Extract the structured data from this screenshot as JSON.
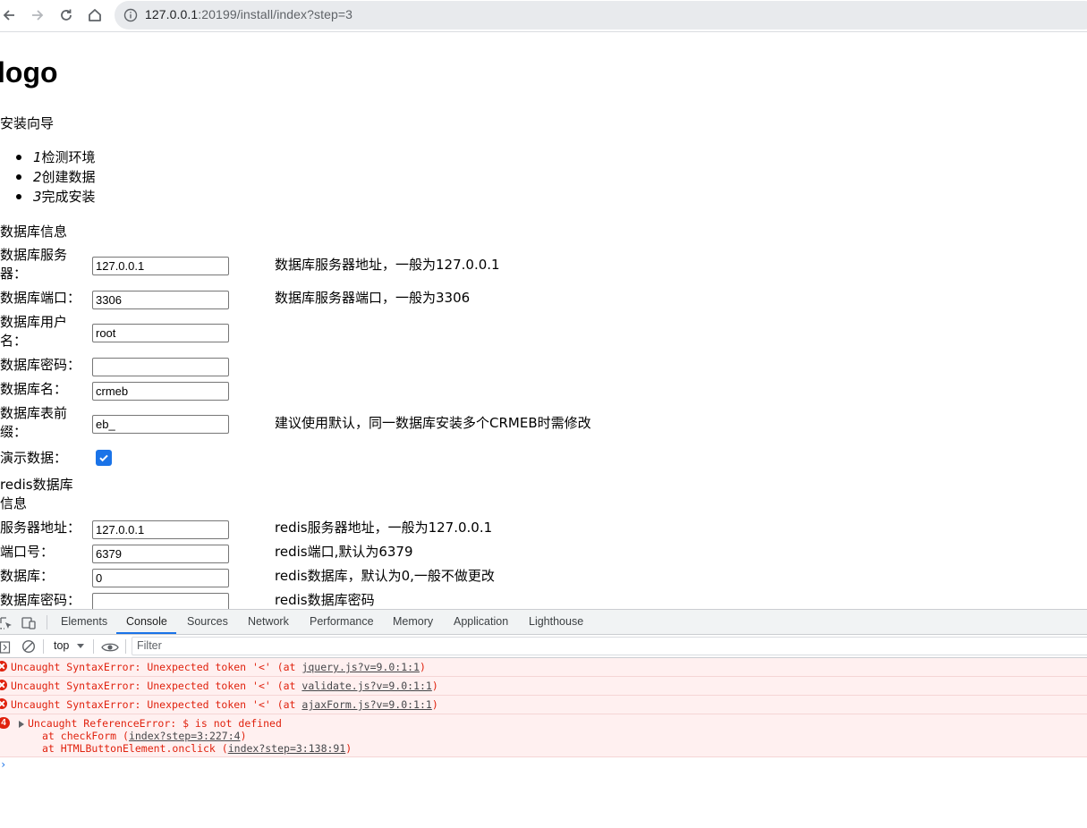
{
  "browser": {
    "url_host": "127.0.0.1",
    "url_rest": ":20199/install/index?step=3"
  },
  "page": {
    "logo": "logo",
    "guide_title": "安装向导",
    "steps": [
      {
        "num": "1",
        "label": "检测环境"
      },
      {
        "num": "2",
        "label": "创建数据"
      },
      {
        "num": "3",
        "label": "完成安装"
      }
    ],
    "db_section": "数据库信息",
    "db_fields": {
      "server": {
        "label": "数据库服务器：",
        "value": "127.0.0.1",
        "hint": "数据库服务器地址，一般为127.0.0.1"
      },
      "port": {
        "label": "数据库端口：",
        "value": "3306",
        "hint": "数据库服务器端口，一般为3306"
      },
      "user": {
        "label": "数据库用户名：",
        "value": "root"
      },
      "password": {
        "label": "数据库密码：",
        "value": ""
      },
      "name": {
        "label": "数据库名：",
        "value": "crmeb"
      },
      "prefix": {
        "label": "数据库表前缀：",
        "value": "eb_",
        "hint": "建议使用默认，同一数据库安装多个CRMEB时需修改"
      },
      "demo": {
        "label": "演示数据：",
        "checked": true
      }
    },
    "redis_section": "redis数据库信息",
    "redis_fields": {
      "server": {
        "label": "服务器地址：",
        "value": "127.0.0.1",
        "hint": "redis服务器地址，一般为127.0.0.1"
      },
      "port": {
        "label": "端口号：",
        "value": "6379",
        "hint": "redis端口,默认为6379"
      },
      "db": {
        "label": "数据库：",
        "value": "0",
        "hint": "redis数据库，默认为0,一般不做更改"
      },
      "password": {
        "label": "数据库密码：",
        "value": "",
        "hint": "redis数据库密码"
      }
    }
  },
  "devtools": {
    "tabs": [
      "Elements",
      "Console",
      "Sources",
      "Network",
      "Performance",
      "Memory",
      "Application",
      "Lighthouse"
    ],
    "active_tab": "Console",
    "context": "top",
    "filter_placeholder": "Filter",
    "errors": [
      {
        "text": "Uncaught SyntaxError: Unexpected token '<' (at ",
        "link": "jquery.js?v=9.0:1:1",
        "end": ")"
      },
      {
        "text": "Uncaught SyntaxError: Unexpected token '<' (at ",
        "link": "validate.js?v=9.0:1:1",
        "end": ")"
      },
      {
        "text": "Uncaught SyntaxError: Unexpected token '<' (at ",
        "link": "ajaxForm.js?v=9.0:1:1",
        "end": ")"
      }
    ],
    "grouped_error": {
      "count": "4",
      "text": "Uncaught ReferenceError: $ is not defined",
      "stack": [
        {
          "prefix": "at checkForm (",
          "link": "index?step=3:227:4",
          "end": ")"
        },
        {
          "prefix": "at HTMLButtonElement.onclick (",
          "link": "index?step=3:138:91",
          "end": ")"
        }
      ]
    },
    "prompt": "›",
    "colors": {
      "error": "#e0220e",
      "error_bg": "#fff0f0",
      "accent": "#1a73e8"
    }
  }
}
